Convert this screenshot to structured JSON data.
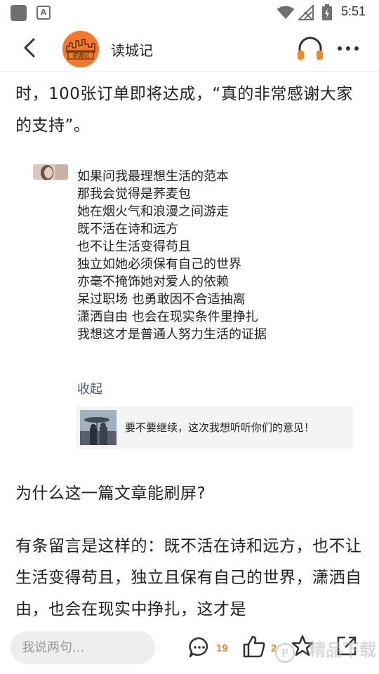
{
  "status_bar": {
    "time": "5:51",
    "notification_icon": "A"
  },
  "header": {
    "brand_name": "读城记",
    "logo_text": "读城记",
    "icons": [
      "back-arrow-icon",
      "headset-icon",
      "more-icon"
    ]
  },
  "article": {
    "para1": "时，100张订单即将达成，“真的非常感谢大家的支持”。",
    "quote": {
      "lines": [
        "如果问我最理想生活的范本",
        "那我会觉得是荞麦包",
        "她在烟火气和浪漫之间游走",
        "既不活在诗和远方",
        "也不让生活变得苟且",
        "独立如她必须保有自己的世界",
        "亦毫不掩饰她对爱人的依赖",
        "呆过职场  也勇敢因不合适抽离",
        "潇洒自由  也会在现实条件里挣扎",
        "我想这才是普通人努力生活的证据"
      ],
      "collapse_label": "收起",
      "embed_text": "要不要继续，这次我想听听你们的意见！"
    },
    "para2": "为什么这一篇文章能刷屏?",
    "para3": "有条留言是这样的：既不活在诗和远方，也不让生活变得苟且，独立且保有自己的世界，潇洒自由，也会在现实中挣扎，这才是"
  },
  "bottom_bar": {
    "comment_placeholder": "我说两句...",
    "comment_count": "19",
    "like_count": "2",
    "watermark_text": "精品下载"
  },
  "colors": {
    "accent": "#f08a24",
    "logo_bg": "#f27a2a",
    "link": "#4a5a7a"
  }
}
